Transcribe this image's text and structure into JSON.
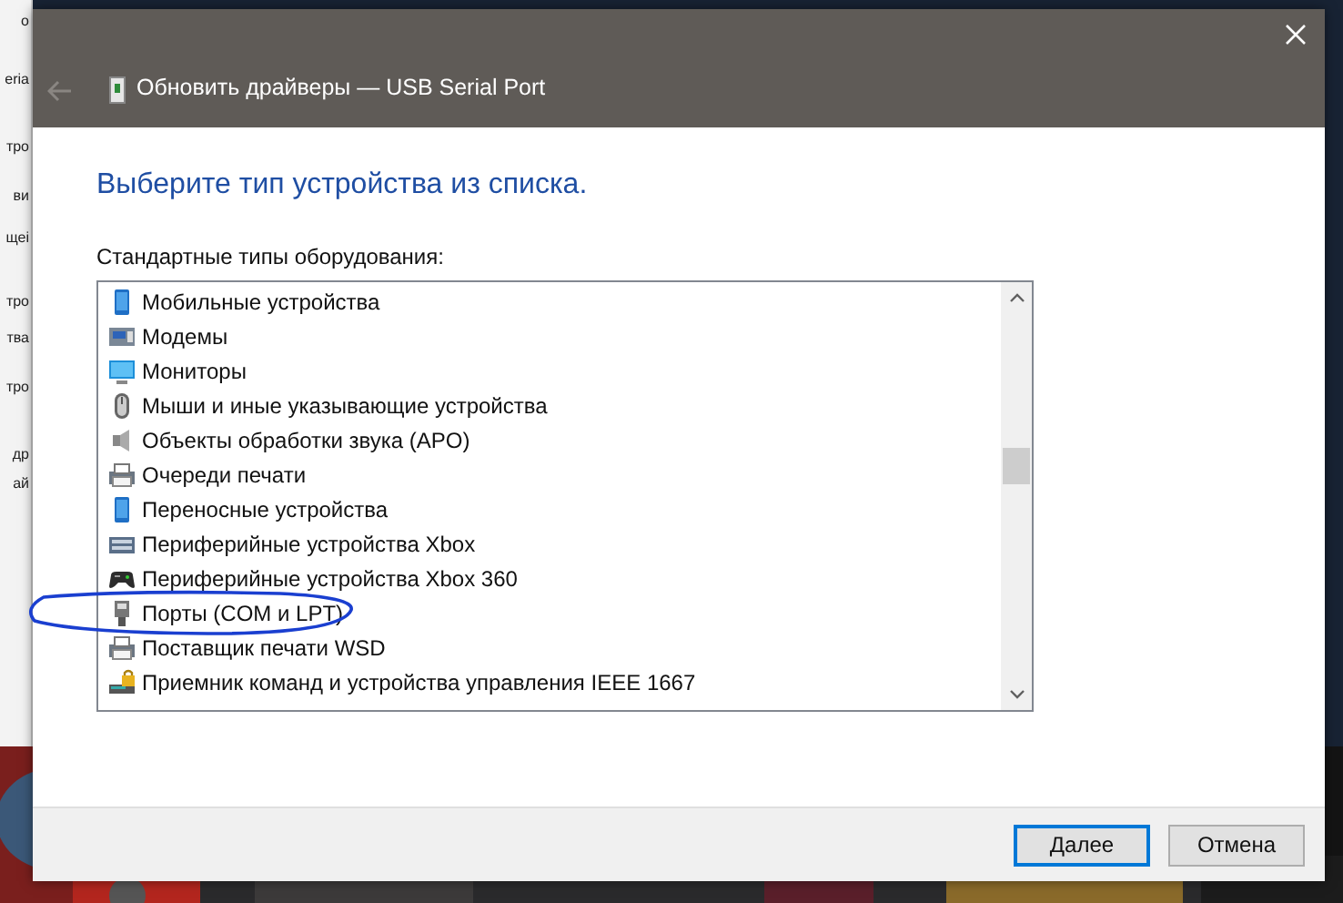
{
  "background_window": {
    "texts": [
      "о",
      "eria",
      "тро",
      "ви",
      "щеі",
      "тро",
      "тва",
      "тро",
      "др",
      "ай"
    ]
  },
  "window": {
    "title": "Обновить драйверы — USB Serial Port",
    "back_disabled": true
  },
  "heading": "Выберите тип устройства из списка.",
  "list_label": "Стандартные типы оборудования:",
  "items": [
    {
      "label": "Мобильные устройства",
      "kind": "phone",
      "circled": false
    },
    {
      "label": "Модемы",
      "kind": "modem",
      "circled": false
    },
    {
      "label": "Мониторы",
      "kind": "monitor",
      "circled": false
    },
    {
      "label": "Мыши и иные указывающие устройства",
      "kind": "mouse",
      "circled": false
    },
    {
      "label": "Объекты обработки звука (APO)",
      "kind": "speaker",
      "circled": false
    },
    {
      "label": "Очереди печати",
      "kind": "printer",
      "circled": false
    },
    {
      "label": "Переносные устройства",
      "kind": "phone",
      "circled": false
    },
    {
      "label": "Периферийные устройства Xbox",
      "kind": "keyboard",
      "circled": false
    },
    {
      "label": "Периферийные устройства Xbox 360",
      "kind": "gamepad",
      "circled": false
    },
    {
      "label": "Порты (COM и LPT)",
      "kind": "port",
      "circled": true
    },
    {
      "label": "Поставщик печати WSD",
      "kind": "printer",
      "circled": false
    },
    {
      "label": "Приемник команд и устройства управления IEEE 1667",
      "kind": "lock",
      "circled": false
    }
  ],
  "buttons": [
    {
      "label": "Далее",
      "default": true
    },
    {
      "label": "Отмена",
      "default": false
    }
  ]
}
